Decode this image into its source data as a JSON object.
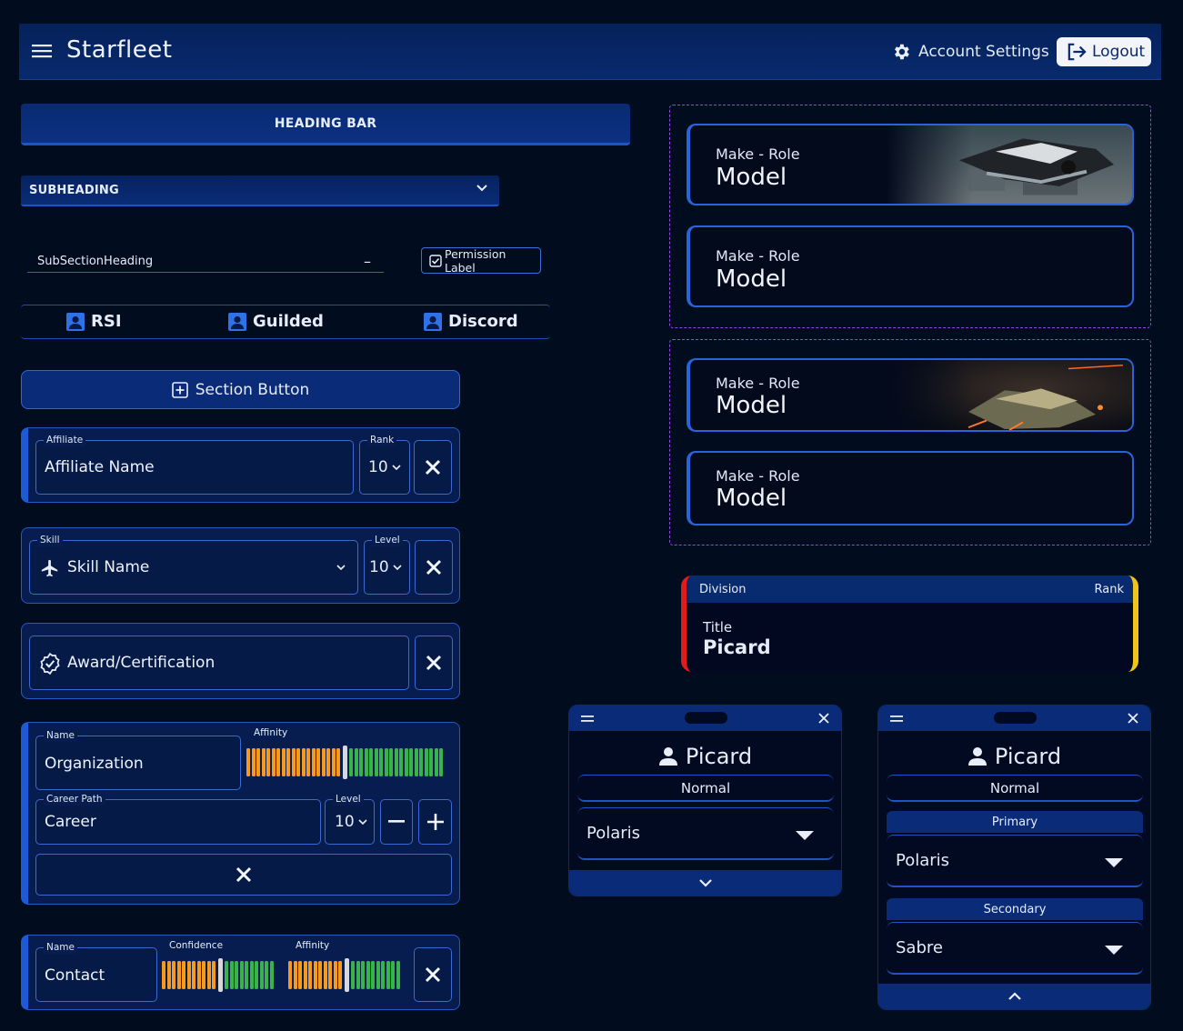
{
  "app": {
    "title": "Starfleet",
    "account_label": "Account Settings",
    "logout_label": "Logout"
  },
  "heading_bar": "HEADING BAR",
  "subheading": "SUBHEADING",
  "subsection": {
    "label": "SubSectionHeading",
    "toggle": "–"
  },
  "permission_label": "Permission Label",
  "links": [
    {
      "label": "RSI"
    },
    {
      "label": "Guilded"
    },
    {
      "label": "Discord"
    }
  ],
  "section_button": "Section Button",
  "affiliate": {
    "label": "Affiliate",
    "value": "Affiliate Name",
    "rank_label": "Rank",
    "rank": "10"
  },
  "skill": {
    "label": "Skill",
    "value": "Skill Name",
    "level_label": "Level",
    "level": "10"
  },
  "award": {
    "value": "Award/Certification"
  },
  "organization": {
    "name_label": "Name",
    "name": "Organization",
    "affinity_label": "Affinity",
    "affinity": 0.5,
    "career_label": "Career Path",
    "career": "Career",
    "level_label": "Level",
    "level": "10"
  },
  "contact": {
    "name_label": "Name",
    "name": "Contact",
    "confidence_label": "Confidence",
    "confidence": 0.5,
    "affinity_label": "Affinity",
    "affinity": 0.5
  },
  "ships": [
    {
      "make_role": "Make - Role",
      "model": "Model",
      "has_image": true
    },
    {
      "make_role": "Make - Role",
      "model": "Model",
      "has_image": false
    },
    {
      "make_role": "Make - Role",
      "model": "Model",
      "has_image": true
    },
    {
      "make_role": "Make - Role",
      "model": "Model",
      "has_image": false
    }
  ],
  "division_card": {
    "division": "Division",
    "rank": "Rank",
    "title": "Title",
    "name": "Picard",
    "left_color": "#e01b1b",
    "right_color": "#f0c419"
  },
  "widget_small": {
    "name": "Picard",
    "status": "Normal",
    "ship": "Polaris"
  },
  "widget_large": {
    "name": "Picard",
    "status": "Normal",
    "primary_label": "Primary",
    "primary": "Polaris",
    "secondary_label": "Secondary",
    "secondary": "Sabre"
  },
  "colors": {
    "background": "#020c1f",
    "primary_blue": "#0a2b78",
    "accent_blue": "#2558c4",
    "bar_orange": "#f59a1e",
    "bar_green": "#38b34a",
    "dashed_purple": "#9a43e8"
  }
}
